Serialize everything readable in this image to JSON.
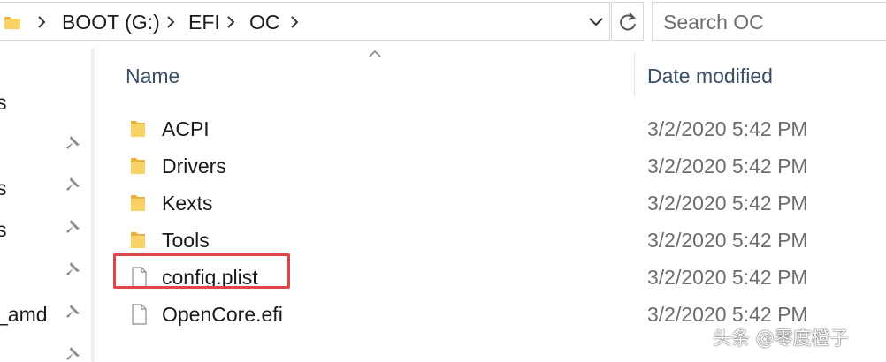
{
  "address_bar": {
    "breadcrumbs": [
      "BOOT (G:)",
      "EFI",
      "OC"
    ],
    "folder_icon": "folder-icon",
    "separator_icon": "chevron-right-icon",
    "dropdown_icon": "chevron-down-icon",
    "refresh_icon": "refresh-icon"
  },
  "search": {
    "placeholder": "Search OC",
    "value": ""
  },
  "nav_pane": {
    "partial_labels": [
      "s",
      "s",
      "s",
      "_amd"
    ],
    "pin_icon": "pin-icon"
  },
  "file_list": {
    "columns": {
      "name": "Name",
      "date_modified": "Date modified"
    },
    "sort_icon": "sort-ascending-icon",
    "rows": [
      {
        "name": "ACPI",
        "date": "3/2/2020 5:42 PM",
        "icon": "folder-icon"
      },
      {
        "name": "Drivers",
        "date": "3/2/2020 5:42 PM",
        "icon": "folder-icon"
      },
      {
        "name": "Kexts",
        "date": "3/2/2020 5:42 PM",
        "icon": "folder-icon"
      },
      {
        "name": "Tools",
        "date": "3/2/2020 5:42 PM",
        "icon": "folder-icon"
      },
      {
        "name": "config.plist",
        "date": "3/2/2020 5:42 PM",
        "icon": "file-icon"
      },
      {
        "name": "OpenCore.efi",
        "date": "3/2/2020 5:42 PM",
        "icon": "file-icon"
      }
    ],
    "highlighted_row": "config.plist"
  },
  "colors": {
    "highlight_border": "#e0454a",
    "folder_yellow": "#f8d264",
    "header_text": "#3b4f66",
    "date_text": "#6d6d6d"
  },
  "watermark": {
    "text": "头条 @零度橙子"
  }
}
